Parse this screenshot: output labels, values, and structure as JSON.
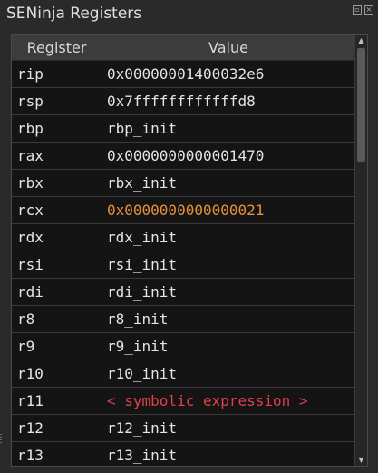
{
  "window": {
    "title": "SENinja Registers",
    "float_icon": "float-window-icon",
    "close_icon": "close-window-icon"
  },
  "table": {
    "columns": [
      "Register",
      "Value"
    ],
    "rows": [
      {
        "register": "rip",
        "value": "0x00000001400032e6",
        "value_color": "#e4e4e4"
      },
      {
        "register": "rsp",
        "value": "0x7ffffffffffffd8",
        "value_color": "#e4e4e4"
      },
      {
        "register": "rbp",
        "value": "rbp_init",
        "value_color": "#e4e4e4"
      },
      {
        "register": "rax",
        "value": "0x0000000000001470",
        "value_color": "#e4e4e4"
      },
      {
        "register": "rbx",
        "value": "rbx_init",
        "value_color": "#e4e4e4"
      },
      {
        "register": "rcx",
        "value": "0x0000000000000021",
        "value_color": "#e8913a"
      },
      {
        "register": "rdx",
        "value": "rdx_init",
        "value_color": "#e4e4e4"
      },
      {
        "register": "rsi",
        "value": "rsi_init",
        "value_color": "#e4e4e4"
      },
      {
        "register": "rdi",
        "value": "rdi_init",
        "value_color": "#e4e4e4"
      },
      {
        "register": "r8",
        "value": "r8_init",
        "value_color": "#e4e4e4"
      },
      {
        "register": "r9",
        "value": "r9_init",
        "value_color": "#e4e4e4"
      },
      {
        "register": "r10",
        "value": "r10_init",
        "value_color": "#e4e4e4"
      },
      {
        "register": "r11",
        "value": "< symbolic expression >",
        "value_color": "#e0404a"
      },
      {
        "register": "r12",
        "value": "r12_init",
        "value_color": "#e4e4e4"
      },
      {
        "register": "r13",
        "value": "r13_init",
        "value_color": "#e4e4e4"
      }
    ]
  },
  "scrollbar": {
    "visible_fraction": 0.28,
    "position": 0.0
  }
}
